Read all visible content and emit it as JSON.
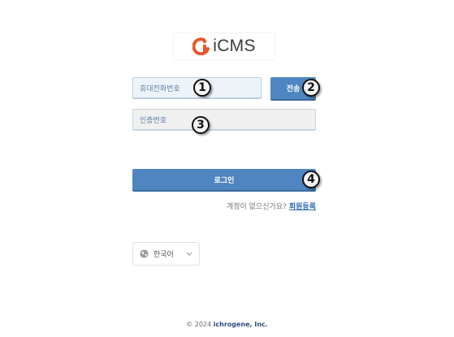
{
  "logo": {
    "text": "iCMS"
  },
  "form": {
    "phone_placeholder": "휴대전화번호",
    "send_label": "전송",
    "code_placeholder": "인증번호",
    "login_label": "로그인"
  },
  "markers": [
    "1",
    "2",
    "3",
    "4"
  ],
  "signup": {
    "prompt": "계정이 없으신가요?",
    "link": "회원등록"
  },
  "language": {
    "selected": "한국어"
  },
  "footer": {
    "copyright": "© 2024",
    "company": "ichrogene, Inc."
  },
  "colors": {
    "primary": "#4f86c1",
    "logo_orange": "#e8572a",
    "link": "#2e6eb5"
  },
  "icons": [
    "logo-mark-icon",
    "globe-icon",
    "chevron-down-icon"
  ]
}
